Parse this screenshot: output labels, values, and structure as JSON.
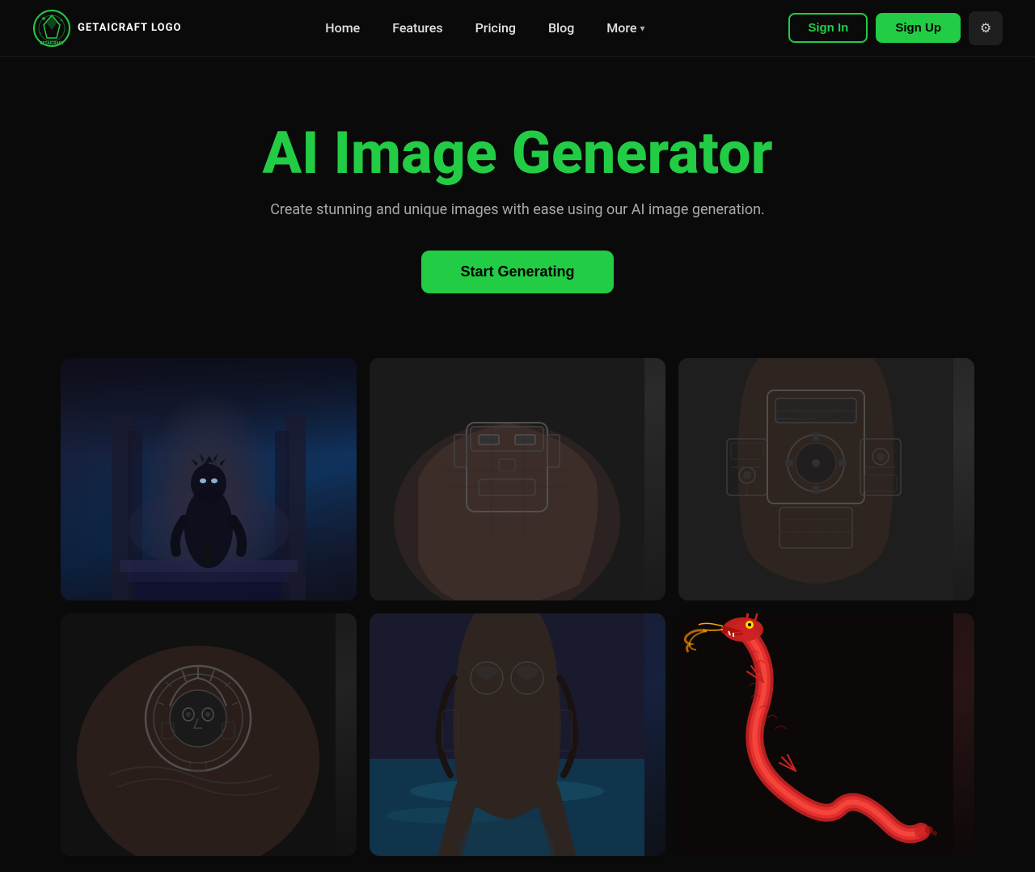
{
  "logo": {
    "text_line1": "GET AI",
    "text_line2": "CRAFT",
    "alt": "GetAICraft Logo"
  },
  "nav": {
    "items": [
      {
        "label": "Home",
        "id": "home"
      },
      {
        "label": "Features",
        "id": "features"
      },
      {
        "label": "Pricing",
        "id": "pricing"
      },
      {
        "label": "Blog",
        "id": "blog"
      },
      {
        "label": "More",
        "id": "more"
      }
    ],
    "signin_label": "Sign In",
    "signup_label": "Sign Up",
    "settings_label": "Settings"
  },
  "hero": {
    "title": "AI Image Generator",
    "subtitle": "Create stunning and unique images with ease using our AI image generation.",
    "cta_label": "Start Generating"
  },
  "gallery": {
    "images": [
      {
        "id": "img-1",
        "alt": "Dark creature on stone throne with gothic architecture",
        "row": 1,
        "col": 1
      },
      {
        "id": "img-2",
        "alt": "Mechanical robot head tattoo on shoulder",
        "row": 1,
        "col": 2
      },
      {
        "id": "img-3",
        "alt": "Man with mechanical circuit tattoos on torso",
        "row": 1,
        "col": 3
      },
      {
        "id": "img-4",
        "alt": "Mayan tribal tattoo on shoulder",
        "row": 2,
        "col": 1
      },
      {
        "id": "img-5",
        "alt": "Man with tattoos sitting by pool",
        "row": 2,
        "col": 2
      },
      {
        "id": "img-6",
        "alt": "Red dragon tattoo illustration",
        "row": 2,
        "col": 3
      }
    ]
  },
  "colors": {
    "accent_green": "#22cc44",
    "background": "#0a0a0a",
    "text_muted": "#aaaaaa"
  }
}
